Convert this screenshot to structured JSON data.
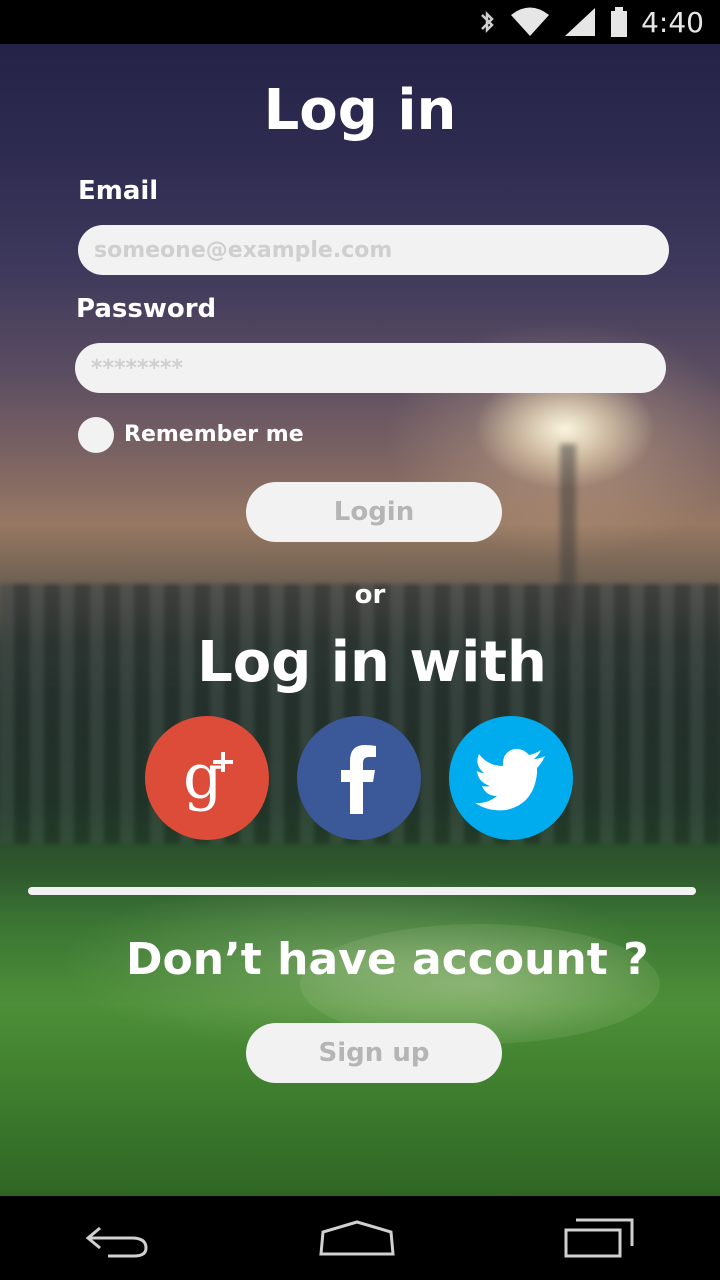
{
  "status_bar": {
    "time": "4:40"
  },
  "login": {
    "title": "Log in",
    "email_label": "Email",
    "email_placeholder": "someone@example.com",
    "password_label": "Password",
    "password_placeholder": "********",
    "remember_label": "Remember me",
    "login_button": "Login",
    "or_text": "or",
    "login_with_title": "Log in with"
  },
  "social": [
    {
      "icon": "google-plus-icon",
      "color": "#dd4b39"
    },
    {
      "icon": "facebook-icon",
      "color": "#3b5998"
    },
    {
      "icon": "twitter-icon",
      "color": "#00acee"
    }
  ],
  "signup": {
    "prompt": "Don’t have account ?",
    "button": "Sign up"
  },
  "nav": {
    "icons": [
      "back-icon",
      "home-icon",
      "recents-icon"
    ]
  }
}
